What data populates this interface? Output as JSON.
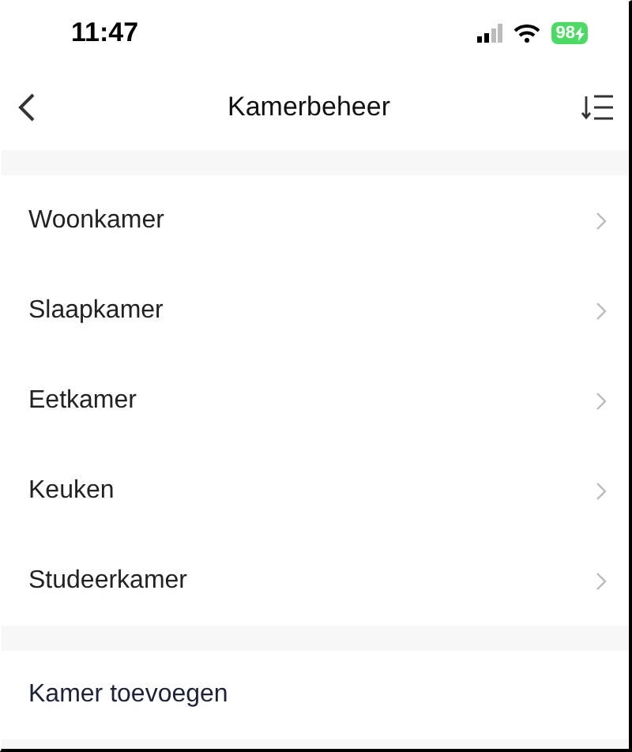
{
  "status_bar": {
    "time": "11:47",
    "battery": "98"
  },
  "nav": {
    "title": "Kamerbeheer"
  },
  "rooms": [
    {
      "name": "Woonkamer"
    },
    {
      "name": "Slaapkamer"
    },
    {
      "name": "Eetkamer"
    },
    {
      "name": "Keuken"
    },
    {
      "name": "Studeerkamer"
    }
  ],
  "add_room": "Kamer toevoegen"
}
